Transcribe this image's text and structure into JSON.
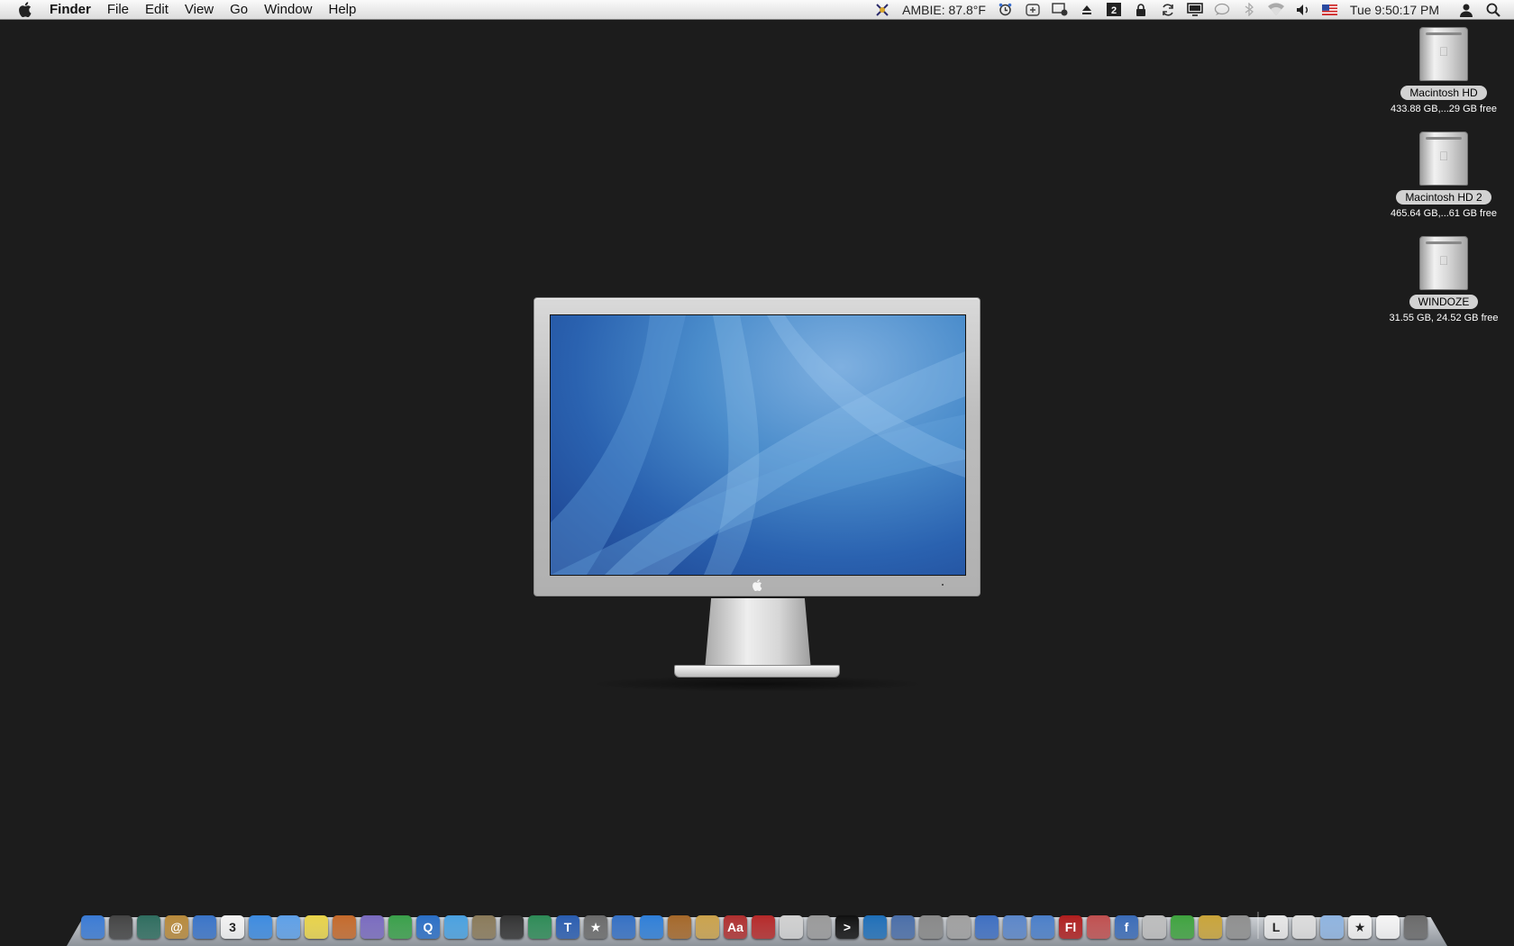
{
  "menubar": {
    "app_name": "Finder",
    "items": [
      "File",
      "Edit",
      "View",
      "Go",
      "Window",
      "Help"
    ],
    "weather": "AMBIE: 87.8°F",
    "clock": "Tue 9:50:17 PM",
    "status_icons": [
      "ambie-icon",
      "alarm-icon",
      "plus-box-icon",
      "display-icon",
      "eject-icon",
      "spaces-icon",
      "lock-icon",
      "sync-icon",
      "screen-icon",
      "chat-icon",
      "bluetooth-icon",
      "wifi-icon",
      "volume-icon",
      "flag-icon",
      "user-icon",
      "spotlight-icon"
    ]
  },
  "desktop": {
    "drives": [
      {
        "name": "Macintosh HD",
        "info": "433.88 GB,...29 GB free"
      },
      {
        "name": "Macintosh HD 2",
        "info": "465.64 GB,...61 GB free"
      },
      {
        "name": "WINDOZE",
        "info": "31.55 GB, 24.52 GB free"
      }
    ]
  },
  "dock": {
    "apps": [
      {
        "name": "finder-icon",
        "color": "#3b7bd4",
        "glyph": ""
      },
      {
        "name": "dashboard-icon",
        "color": "#444444",
        "glyph": ""
      },
      {
        "name": "time-machine-icon",
        "color": "#2f6d5f",
        "glyph": ""
      },
      {
        "name": "address-book-icon",
        "color": "#b88a3c",
        "glyph": "@"
      },
      {
        "name": "mail-stamp-icon",
        "color": "#3a74c8",
        "glyph": ""
      },
      {
        "name": "ical-icon",
        "color": "#f2f2f2",
        "glyph": "3"
      },
      {
        "name": "safari-icon",
        "color": "#3d8be0",
        "glyph": ""
      },
      {
        "name": "ichat-icon",
        "color": "#5ea0e8",
        "glyph": ""
      },
      {
        "name": "stickies-icon",
        "color": "#e8d34a",
        "glyph": ""
      },
      {
        "name": "keynote-icon",
        "color": "#c46a2c",
        "glyph": ""
      },
      {
        "name": "brush-icon",
        "color": "#7a6bbf",
        "glyph": ""
      },
      {
        "name": "numbers-icon",
        "color": "#3aa04a",
        "glyph": ""
      },
      {
        "name": "quicktime-icon",
        "color": "#2b6fc6",
        "glyph": "Q"
      },
      {
        "name": "itunes-icon",
        "color": "#4aa1e0",
        "glyph": ""
      },
      {
        "name": "iphoto-icon",
        "color": "#8a7a5a",
        "glyph": ""
      },
      {
        "name": "photo-booth-icon",
        "color": "#333333",
        "glyph": ""
      },
      {
        "name": "itunes-music-icon",
        "color": "#2e8b57",
        "glyph": ""
      },
      {
        "name": "text-editor-icon",
        "color": "#2a5db0",
        "glyph": "T"
      },
      {
        "name": "imovie-star-icon",
        "color": "#6b6b6b",
        "glyph": "★"
      },
      {
        "name": "clapper-icon",
        "color": "#3570c4",
        "glyph": ""
      },
      {
        "name": "idvd-icon",
        "color": "#2f7fd8",
        "glyph": ""
      },
      {
        "name": "garageband-icon",
        "color": "#a5682a",
        "glyph": ""
      },
      {
        "name": "preview-icon",
        "color": "#caa24c",
        "glyph": ""
      },
      {
        "name": "dictionary-icon",
        "color": "#b03030",
        "glyph": "Aa"
      },
      {
        "name": "photo-stack-icon",
        "color": "#b52a2a",
        "glyph": ""
      },
      {
        "name": "textedit-pen-icon",
        "color": "#d0d0d0",
        "glyph": ""
      },
      {
        "name": "calculator-icon",
        "color": "#9a9a9a",
        "glyph": ""
      },
      {
        "name": "terminal-icon",
        "color": "#111111",
        "glyph": ">"
      },
      {
        "name": "quicktime-player-icon",
        "color": "#1f6fb8",
        "glyph": ""
      },
      {
        "name": "system-profiler-icon",
        "color": "#4a6ea8",
        "glyph": ""
      },
      {
        "name": "disk-utility-icon",
        "color": "#888888",
        "glyph": ""
      },
      {
        "name": "scanner-icon",
        "color": "#a0a0a0",
        "glyph": ""
      },
      {
        "name": "flash-ff-icon",
        "color": "#3e6fc2",
        "glyph": ""
      },
      {
        "name": "script-editor-icon",
        "color": "#5b86c9",
        "glyph": ""
      },
      {
        "name": "dreamweaver-icon",
        "color": "#4b7fc9",
        "glyph": ""
      },
      {
        "name": "flash-icon",
        "color": "#b01f1f",
        "glyph": "Fl"
      },
      {
        "name": "utility-red-icon",
        "color": "#c05050",
        "glyph": ""
      },
      {
        "name": "flash-player-icon",
        "color": "#3b6cb8",
        "glyph": "f"
      },
      {
        "name": "hard-drive-icon",
        "color": "#bdbdbd",
        "glyph": ""
      },
      {
        "name": "settings-gear-icon",
        "color": "#3fa33f",
        "glyph": ""
      },
      {
        "name": "sun-icon",
        "color": "#c9a43a",
        "glyph": ""
      },
      {
        "name": "system-prefs-icon",
        "color": "#8f8f8f",
        "glyph": ""
      }
    ],
    "stacks": [
      {
        "name": "documents-stack-icon",
        "color": "#e6e6e6",
        "glyph": "L"
      },
      {
        "name": "downloads-stack-icon",
        "color": "#dcdcdc",
        "glyph": ""
      },
      {
        "name": "applications-folder-icon",
        "color": "#8fb4e0",
        "glyph": ""
      },
      {
        "name": "favorites-stack-icon",
        "color": "#f0f0f0",
        "glyph": "★"
      },
      {
        "name": "document-file-icon",
        "color": "#f4f4f4",
        "glyph": ""
      },
      {
        "name": "trash-icon",
        "color": "#6a6a6a",
        "glyph": ""
      }
    ]
  }
}
